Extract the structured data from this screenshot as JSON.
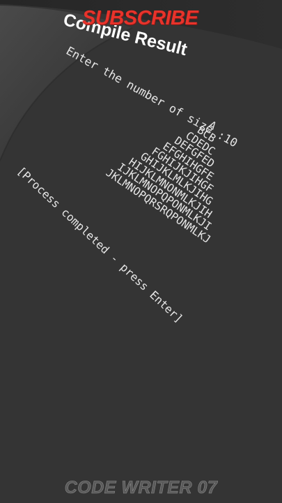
{
  "banner": {
    "subscribe": "SUBSCRIBE"
  },
  "window": {
    "title": "Compile Result"
  },
  "console": {
    "prompt": "Enter the number of size :10",
    "pattern_rows": [
      "A",
      "BCB",
      "CDEDC",
      "DEFGFED",
      "EFGHIHGFE",
      "FGHIJKJIHGF",
      "GHIJKLMLKJIHG",
      "HIJKLMNONMLKJIH",
      "IJKLMNOPQPONMLKJI",
      "JKLMNOPQRSRQPONMLKJ"
    ],
    "process_message": "[Process completed - press Enter]"
  },
  "watermark": {
    "text": "CODE WRITER 07"
  },
  "colors": {
    "background": "#343434",
    "title": "#ffffff",
    "console_text": "#e6e6e6",
    "subscribe": "#e8332b",
    "watermark": "#5a5a5a"
  }
}
